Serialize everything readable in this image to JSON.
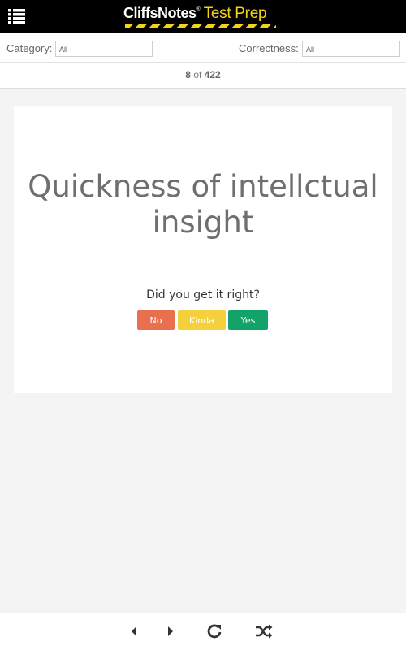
{
  "header": {
    "brand": "CliffsNotes",
    "reg": "®",
    "product": "Test Prep"
  },
  "filters": {
    "category_label": "Category:",
    "category_value": "All",
    "correctness_label": "Correctness:",
    "correctness_value": "All"
  },
  "counter": {
    "current": "8",
    "of": "of",
    "total": "422"
  },
  "card": {
    "term": "Quickness of intellctual insight",
    "prompt": "Did you get it right?",
    "buttons": {
      "no": "No",
      "kinda": "Kinda",
      "yes": "Yes"
    }
  },
  "colors": {
    "no": "#e8704f",
    "kinda": "#f4d03c",
    "yes": "#11a36a",
    "brand_yellow": "#f2d21b"
  },
  "icons": [
    "menu-icon",
    "prev-icon",
    "next-icon",
    "reload-icon",
    "shuffle-icon"
  ]
}
